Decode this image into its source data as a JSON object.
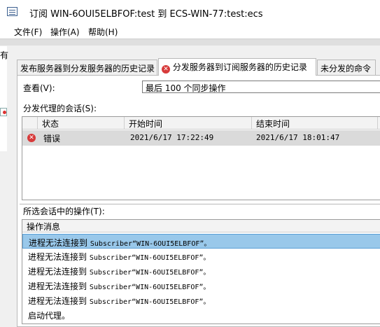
{
  "window": {
    "title": "订阅 WIN-6OUI5ELBFOF:test 到 ECS-WIN-77:test:ecs"
  },
  "menu": {
    "items": [
      "文件(F)",
      "操作(A)",
      "帮助(H)"
    ]
  },
  "outer_fragment": {
    "text": "有"
  },
  "tabs": [
    {
      "label": "发布服务器到分发服务器的历史记录",
      "active": false
    },
    {
      "label": "分发服务器到订阅服务器的历史记录",
      "active": true,
      "icon": "error-icon"
    },
    {
      "label": "未分发的命令",
      "active": false
    }
  ],
  "view": {
    "label": "查看(V):",
    "selected": "最后 100 个同步操作"
  },
  "sessions": {
    "label": "分发代理的会话(S):",
    "columns": [
      "状态",
      "开始时间",
      "结束时间"
    ],
    "rows": [
      {
        "status": "错误",
        "start": "2021/6/17 17:22:49",
        "end": "2021/6/17 18:01:47",
        "status_icon": "error-icon"
      }
    ]
  },
  "operations": {
    "label": "所选会话中的操作(T):",
    "column": "操作消息",
    "rows": [
      {
        "prefix": "进程无法连接到 ",
        "detail": "Subscriber“WIN-6OUI5ELBFOF”。",
        "selected": true
      },
      {
        "prefix": "进程无法连接到 ",
        "detail": "Subscriber“WIN-6OUI5ELBFOF”。",
        "selected": false
      },
      {
        "prefix": "进程无法连接到 ",
        "detail": "Subscriber“WIN-6OUI5ELBFOF”。",
        "selected": false
      },
      {
        "prefix": "进程无法连接到 ",
        "detail": "Subscriber“WIN-6OUI5ELBFOF”。",
        "selected": false
      },
      {
        "prefix": "进程无法连接到 ",
        "detail": "Subscriber“WIN-6OUI5ELBFOF”。",
        "selected": false
      },
      {
        "prefix": "启动代理。",
        "detail": "",
        "selected": false
      }
    ]
  },
  "colors": {
    "selection": "#99c8ea",
    "error": "#d73a3a",
    "session_row": "#dadada"
  }
}
